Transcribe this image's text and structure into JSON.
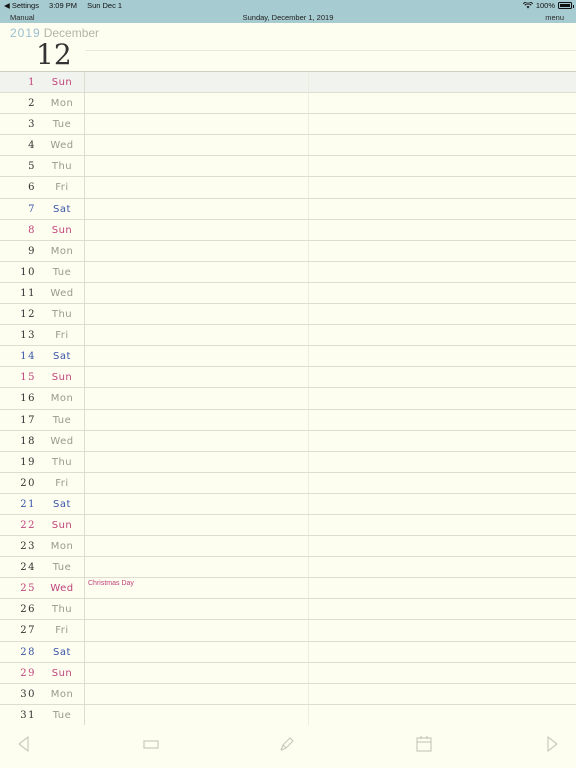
{
  "status_bar": {
    "back_app": "◀ Settings",
    "time": "3:09 PM",
    "date": "Sun Dec 1",
    "battery": "100%"
  },
  "nav": {
    "left": "Manual",
    "title": "Sunday, December 1, 2019",
    "right": "menu"
  },
  "header": {
    "year": "2019",
    "month_name": "December",
    "month_num": "12"
  },
  "days": [
    {
      "num": "1",
      "dow": "Sun",
      "kind": "sun"
    },
    {
      "num": "2",
      "dow": "Mon",
      "kind": "week"
    },
    {
      "num": "3",
      "dow": "Tue",
      "kind": "week"
    },
    {
      "num": "4",
      "dow": "Wed",
      "kind": "week"
    },
    {
      "num": "5",
      "dow": "Thu",
      "kind": "week"
    },
    {
      "num": "6",
      "dow": "Fri",
      "kind": "week"
    },
    {
      "num": "7",
      "dow": "Sat",
      "kind": "sat"
    },
    {
      "num": "8",
      "dow": "Sun",
      "kind": "sun"
    },
    {
      "num": "9",
      "dow": "Mon",
      "kind": "week"
    },
    {
      "num": "10",
      "dow": "Tue",
      "kind": "week"
    },
    {
      "num": "11",
      "dow": "Wed",
      "kind": "week"
    },
    {
      "num": "12",
      "dow": "Thu",
      "kind": "week"
    },
    {
      "num": "13",
      "dow": "Fri",
      "kind": "week"
    },
    {
      "num": "14",
      "dow": "Sat",
      "kind": "sat"
    },
    {
      "num": "15",
      "dow": "Sun",
      "kind": "sun"
    },
    {
      "num": "16",
      "dow": "Mon",
      "kind": "week"
    },
    {
      "num": "17",
      "dow": "Tue",
      "kind": "week"
    },
    {
      "num": "18",
      "dow": "Wed",
      "kind": "week"
    },
    {
      "num": "19",
      "dow": "Thu",
      "kind": "week"
    },
    {
      "num": "20",
      "dow": "Fri",
      "kind": "week"
    },
    {
      "num": "21",
      "dow": "Sat",
      "kind": "sat"
    },
    {
      "num": "22",
      "dow": "Sun",
      "kind": "sun"
    },
    {
      "num": "23",
      "dow": "Mon",
      "kind": "week"
    },
    {
      "num": "24",
      "dow": "Tue",
      "kind": "week"
    },
    {
      "num": "25",
      "dow": "Wed",
      "kind": "holiday",
      "event": "Christmas Day"
    },
    {
      "num": "26",
      "dow": "Thu",
      "kind": "week"
    },
    {
      "num": "27",
      "dow": "Fri",
      "kind": "week"
    },
    {
      "num": "28",
      "dow": "Sat",
      "kind": "sat"
    },
    {
      "num": "29",
      "dow": "Sun",
      "kind": "sun"
    },
    {
      "num": "30",
      "dow": "Mon",
      "kind": "week"
    },
    {
      "num": "31",
      "dow": "Tue",
      "kind": "week"
    }
  ],
  "toolbar": {
    "icons": [
      "prev-arrow-icon",
      "rectangle-icon",
      "pen-icon",
      "calendar-icon",
      "next-arrow-icon"
    ],
    "icon_color": "#c9c9bd"
  },
  "colors": {
    "bar": "#a6cbd1",
    "paper": "#fdfdf0",
    "sunday": "#c0447c",
    "saturday": "#3b56a8"
  }
}
